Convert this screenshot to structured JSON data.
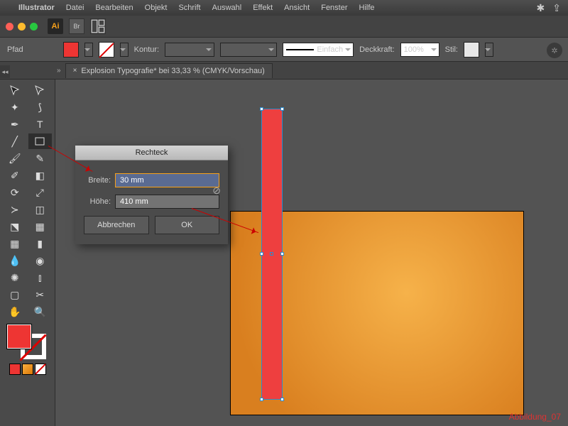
{
  "menubar": {
    "app": "Illustrator",
    "items": [
      "Datei",
      "Bearbeiten",
      "Objekt",
      "Schrift",
      "Auswahl",
      "Effekt",
      "Ansicht",
      "Fenster",
      "Hilfe"
    ]
  },
  "titlebar": {
    "ai": "Ai",
    "br": "Br"
  },
  "ctrl": {
    "path_label": "Pfad",
    "stroke_label": "Kontur:",
    "stroke_weight": "",
    "brush_label": "Einfach",
    "opacity_label": "Deckkraft:",
    "opacity_value": "100%",
    "style_label": "Stil:"
  },
  "tab": {
    "title": "Explosion Typografie* bei 33,33 % (CMYK/Vorschau)"
  },
  "dialog": {
    "title": "Rechteck",
    "width_label": "Breite:",
    "width_value": "30 mm",
    "height_label": "Höhe:",
    "height_value": "410 mm",
    "cancel": "Abbrechen",
    "ok": "OK"
  },
  "caption": "Abbildung_07"
}
